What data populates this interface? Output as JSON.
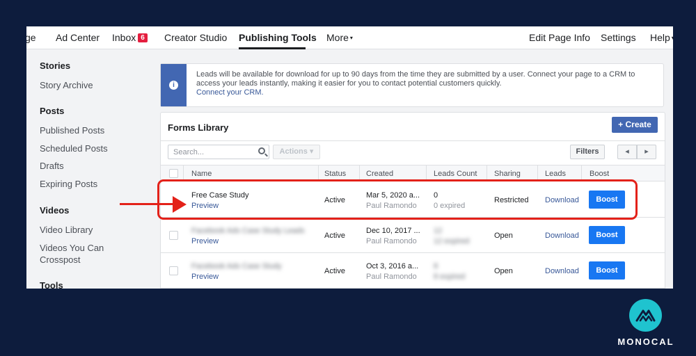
{
  "nav": {
    "items": [
      "ge",
      "Ad Center",
      "Inbox",
      "Creator Studio",
      "Publishing Tools",
      "More",
      "Edit Page Info",
      "Settings",
      "Help"
    ],
    "inbox_count": "6",
    "more_caret": "▾",
    "help_caret": "▾"
  },
  "sidebar": {
    "stories": "Stories",
    "story_archive": "Story Archive",
    "posts": "Posts",
    "published_posts": "Published Posts",
    "scheduled_posts": "Scheduled Posts",
    "drafts": "Drafts",
    "expiring_posts": "Expiring Posts",
    "videos": "Videos",
    "video_library": "Video Library",
    "videos_crosspost_1": "Videos You Can",
    "videos_crosspost_2": "Crosspost",
    "tools": "Tools"
  },
  "notice": {
    "icon": "info-icon",
    "text": "Leads will be available for download for up to 90 days from the time they are submitted by a user. Connect your page to a CRM to access your leads instantly, making it easier for you to contact potential customers quickly.",
    "link": "Connect your CRM."
  },
  "forms": {
    "title": "Forms Library",
    "create": "+ Create",
    "search_placeholder": "Search...",
    "actions": "Actions ▾",
    "filters": "Filters",
    "prev": "◂",
    "next": "▸",
    "headers": [
      "Name",
      "Status",
      "Created",
      "Leads Count",
      "Sharing",
      "Leads",
      "Boost"
    ],
    "rows": [
      {
        "name": "Free Case Study",
        "preview": "Preview",
        "status": "Active",
        "created": "Mar 5, 2020 a...",
        "author": "Paul Ramondo",
        "leads": "0",
        "leads_sub": "0 expired",
        "sharing": "Restricted",
        "download": "Download",
        "boost": "Boost"
      },
      {
        "name": "Facebook Ads Case Study Leads",
        "preview": "Preview",
        "status": "Active",
        "created": "Dec 10, 2017 ...",
        "author": "Paul Ramondo",
        "leads": "12",
        "leads_sub": "12 expired",
        "sharing": "Open",
        "download": "Download",
        "boost": "Boost"
      },
      {
        "name": "Facebook Ads Case Study",
        "preview": "Preview",
        "status": "Active",
        "created": "Oct 3, 2016 a...",
        "author": "Paul Ramondo",
        "leads": "8",
        "leads_sub": "8 expired",
        "sharing": "Open",
        "download": "Download",
        "boost": "Boost"
      }
    ]
  },
  "brand": {
    "name": "MONOCAL",
    "logo_icon": "mountain-logo-icon",
    "accent": "#1fc3cf"
  },
  "colors": {
    "background": "#0d1c3d",
    "highlight": "#e32119",
    "fb_blue": "#4267b2",
    "boost_blue": "#1877f2"
  }
}
